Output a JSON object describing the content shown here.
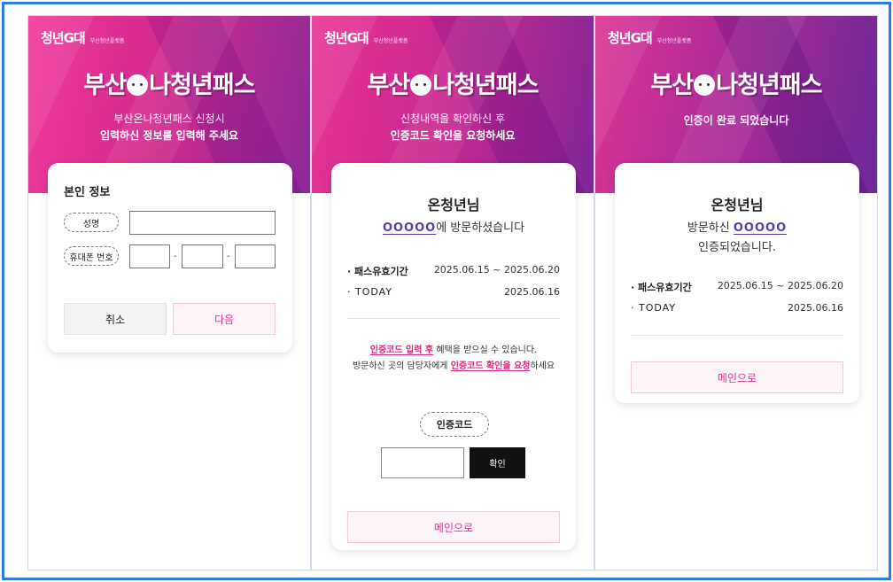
{
  "brand": {
    "name": "청년G대",
    "sub": "부산청년플랫폼"
  },
  "logo": {
    "prefix": "부산",
    "suffix": "나청년패스"
  },
  "screen1": {
    "hero_line1": "부산온나청년패스 신청시",
    "hero_line2": "입력하신 정보를 입력해 주세요",
    "section_title": "본인 정보",
    "name_label": "성명",
    "phone_label": "휴대폰 번호",
    "dash": "-",
    "cancel_label": "취소",
    "next_label": "다음"
  },
  "screen2": {
    "hero_line1": "신청내역을 확인하신 후",
    "hero_line2": "인증코드 확인을 요청하세요",
    "greeting": "온청년님",
    "place": "OOOOO",
    "visit_suffix": "에 방문하셨습니다",
    "period_label": "· 패스유효기간",
    "period_value": "2025.06.15 ~ 2025.06.20",
    "today_label": "· TODAY",
    "today_value": "2025.06.16",
    "notice1_highlight": "인증코드 입력 후",
    "notice1_rest": " 혜택을 받으실 수 있습니다.",
    "notice2_prefix": "방문하신 곳의 담당자에게 ",
    "notice2_highlight": "인증코드 확인을 요청",
    "notice2_suffix": "하세요",
    "code_label": "인증코드",
    "confirm_label": "확인",
    "main_label": "메인으로"
  },
  "screen3": {
    "hero_line1": "인증이 완료 되었습니다",
    "greeting": "온청년님",
    "visit_prefix": "방문하신 ",
    "place": "OOOOO",
    "certified": "인증되었습니다.",
    "period_label": "· 패스유효기간",
    "period_value": "2025.06.15 ~ 2025.06.20",
    "today_label": "· TODAY",
    "today_value": "2025.06.16",
    "main_label": "메인으로"
  }
}
